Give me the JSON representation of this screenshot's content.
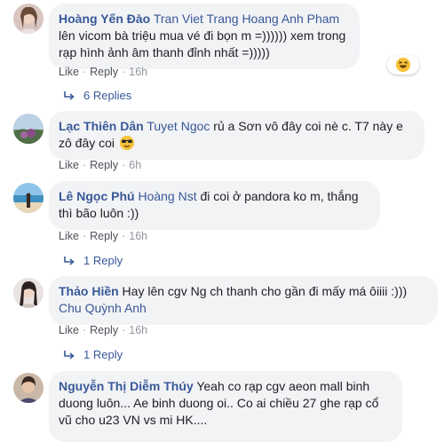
{
  "comments": [
    {
      "author": "Hoàng Yến Đào",
      "tags": "Tran Viet Trang Hoang Anh Pham",
      "text": " lên vicom bà triệu mua vé đi bọn m =)))))) xem trong rạp hình ảnh âm thanh đỉnh nhất =)))))",
      "like": "Like",
      "reply": "Reply",
      "time": "16h",
      "replies": "6 Replies",
      "reaction": "laughing-emoji"
    },
    {
      "author": "Lạc Thiên Dân",
      "tags": "Tuyet Ngoc",
      "text": " rủ a Sơn vô đây coi nè c. T7 này e zô đây coi",
      "like": "Like",
      "reply": "Reply",
      "time": "6h",
      "emoji": "sunglasses-emoji"
    },
    {
      "author": "Lê Ngọc Phú",
      "tags": "Hoàng Nst",
      "text": " đi coi ở pandora ko m, thắng thì bão luôn :))",
      "like": "Like",
      "reply": "Reply",
      "time": "16h",
      "replies": "1 Reply"
    },
    {
      "author": "Thảo Hiền",
      "text_before": " Hay lên cgv Ng ch thanh cho gần đi mấy má ôiiii :))) ",
      "tags": "Chu Quỳnh Anh",
      "like": "Like",
      "reply": "Reply",
      "time": "16h",
      "replies": "1 Reply"
    },
    {
      "author": "Nguyễn Thị Diễm Thúy",
      "text": " Yeah co rạp cgv aeon mall binh duong luôn... Ae binh duong oi.. Co ai chiều 27 ghe rạp cổ vũ cho u23 VN vs mi HK...."
    }
  ],
  "separator": "·",
  "colors": {
    "link": "#385898",
    "bubble": "#f2f3f5",
    "muted": "#90949c"
  }
}
